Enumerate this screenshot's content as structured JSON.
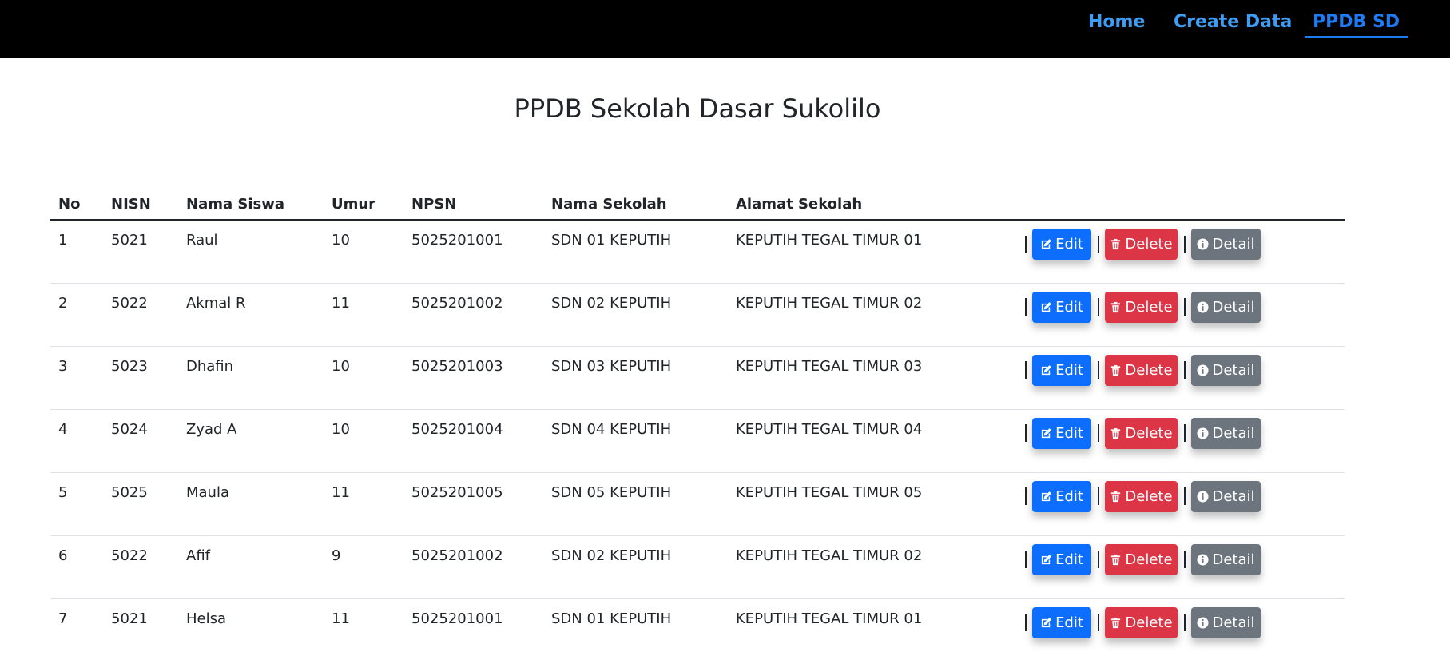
{
  "nav": {
    "home": "Home",
    "create": "Create Data",
    "ppdb": "PPDB SD"
  },
  "page": {
    "title": "PPDB Sekolah Dasar Sukolilo"
  },
  "table": {
    "headers": [
      "No",
      "NISN",
      "Nama Siswa",
      "Umur",
      "NPSN",
      "Nama Sekolah",
      "Alamat Sekolah"
    ],
    "rows": [
      {
        "no": "1",
        "nisn": "5021",
        "nama": "Raul",
        "umur": "10",
        "npsn": "5025201001",
        "sekolah": "SDN 01 KEPUTIH",
        "alamat": "KEPUTIH TEGAL TIMUR 01"
      },
      {
        "no": "2",
        "nisn": "5022",
        "nama": "Akmal R",
        "umur": "11",
        "npsn": "5025201002",
        "sekolah": "SDN 02 KEPUTIH",
        "alamat": "KEPUTIH TEGAL TIMUR 02"
      },
      {
        "no": "3",
        "nisn": "5023",
        "nama": "Dhafin",
        "umur": "10",
        "npsn": "5025201003",
        "sekolah": "SDN 03 KEPUTIH",
        "alamat": "KEPUTIH TEGAL TIMUR 03"
      },
      {
        "no": "4",
        "nisn": "5024",
        "nama": "Zyad A",
        "umur": "10",
        "npsn": "5025201004",
        "sekolah": "SDN 04 KEPUTIH",
        "alamat": "KEPUTIH TEGAL TIMUR 04"
      },
      {
        "no": "5",
        "nisn": "5025",
        "nama": "Maula",
        "umur": "11",
        "npsn": "5025201005",
        "sekolah": "SDN 05 KEPUTIH",
        "alamat": "KEPUTIH TEGAL TIMUR 05"
      },
      {
        "no": "6",
        "nisn": "5022",
        "nama": "Afif",
        "umur": "9",
        "npsn": "5025201002",
        "sekolah": "SDN 02 KEPUTIH",
        "alamat": "KEPUTIH TEGAL TIMUR 02"
      },
      {
        "no": "7",
        "nisn": "5021",
        "nama": "Helsa",
        "umur": "11",
        "npsn": "5025201001",
        "sekolah": "SDN 01 KEPUTIH",
        "alamat": "KEPUTIH TEGAL TIMUR 01"
      }
    ]
  },
  "actions": {
    "edit": "Edit",
    "delete": "Delete",
    "detail": "Detail",
    "separator": "|"
  },
  "colors": {
    "navbar_bg": "#000000",
    "nav_link": "#3d9df5",
    "nav_active": "#1e7bf2",
    "edit_btn": "#0d6efd",
    "delete_btn": "#dc3545",
    "detail_btn": "#6c757d"
  },
  "icons": {
    "edit": "edit-icon",
    "delete": "trash-icon",
    "detail": "info-circle-icon"
  }
}
